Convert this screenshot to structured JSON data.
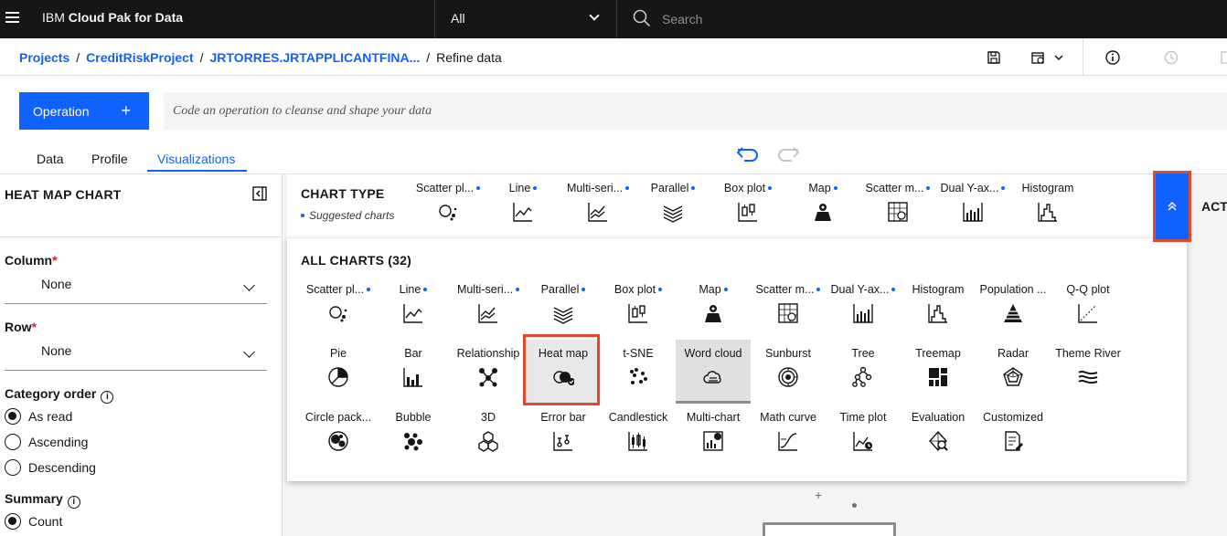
{
  "header": {
    "brand_prefix": "IBM ",
    "brand_name": "Cloud Pak for Data",
    "scope_value": "All",
    "search_placeholder": "Search"
  },
  "breadcrumb": {
    "items": [
      "Projects",
      "CreditRiskProject",
      "JRTORRES.JRTAPPLICANTFINA..."
    ],
    "current": "Refine data"
  },
  "operation": {
    "button_label": "Operation",
    "button_plus": "+",
    "code_placeholder": "Code an operation to cleanse and shape your data"
  },
  "tabs": [
    "Data",
    "Profile",
    "Visualizations"
  ],
  "active_tab": "Visualizations",
  "left_panel": {
    "title": "HEAT MAP CHART",
    "column_label": "Column",
    "column_value": "None",
    "row_label": "Row",
    "row_value": "None",
    "required_mark": "*",
    "category_order_label": "Category order",
    "category_order_options": [
      "As read",
      "Ascending",
      "Descending"
    ],
    "category_order_selected": "As read",
    "summary_label": "Summary",
    "summary_options": [
      "Count"
    ],
    "summary_selected": "Count"
  },
  "chart_type": {
    "title": "CHART TYPE",
    "suggested_note": "Suggested charts",
    "suggested": [
      {
        "label": "Scatter pl...",
        "icon": "scatter-plot-icon",
        "suggested": true
      },
      {
        "label": "Line",
        "icon": "line-chart-icon",
        "suggested": true
      },
      {
        "label": "Multi-seri...",
        "icon": "multi-series-icon",
        "suggested": true
      },
      {
        "label": "Parallel",
        "icon": "parallel-icon",
        "suggested": true
      },
      {
        "label": "Box plot",
        "icon": "box-plot-icon",
        "suggested": true
      },
      {
        "label": "Map",
        "icon": "map-icon",
        "suggested": true
      },
      {
        "label": "Scatter m...",
        "icon": "scatter-matrix-icon",
        "suggested": true
      },
      {
        "label": "Dual Y-ax...",
        "icon": "dual-y-axis-icon",
        "suggested": true
      },
      {
        "label": "Histogram",
        "icon": "histogram-icon",
        "suggested": false
      }
    ],
    "actions_label": "ACTI"
  },
  "all_charts": {
    "title": "ALL CHARTS (32)",
    "rows": [
      [
        {
          "label": "Scatter pl...",
          "icon": "scatter-plot-icon",
          "suggested": true
        },
        {
          "label": "Line",
          "icon": "line-chart-icon",
          "suggested": true
        },
        {
          "label": "Multi-seri...",
          "icon": "multi-series-icon",
          "suggested": true
        },
        {
          "label": "Parallel",
          "icon": "parallel-icon",
          "suggested": true
        },
        {
          "label": "Box plot",
          "icon": "box-plot-icon",
          "suggested": true
        },
        {
          "label": "Map",
          "icon": "map-icon",
          "suggested": true
        },
        {
          "label": "Scatter m...",
          "icon": "scatter-matrix-icon",
          "suggested": true
        },
        {
          "label": "Dual Y-ax...",
          "icon": "dual-y-axis-icon",
          "suggested": true
        },
        {
          "label": "Histogram",
          "icon": "histogram-icon",
          "suggested": false
        },
        {
          "label": "Population ...",
          "icon": "population-pyramid-icon",
          "suggested": false
        },
        {
          "label": "Q-Q plot",
          "icon": "qq-plot-icon",
          "suggested": false
        }
      ],
      [
        {
          "label": "Pie",
          "icon": "pie-chart-icon",
          "suggested": false
        },
        {
          "label": "Bar",
          "icon": "bar-chart-icon",
          "suggested": false
        },
        {
          "label": "Relationship",
          "icon": "relationship-icon",
          "suggested": false
        },
        {
          "label": "Heat map",
          "icon": "heat-map-icon",
          "suggested": false
        },
        {
          "label": "t-SNE",
          "icon": "tsne-icon",
          "suggested": false
        },
        {
          "label": "Word cloud",
          "icon": "word-cloud-icon",
          "suggested": false
        },
        {
          "label": "Sunburst",
          "icon": "sunburst-icon",
          "suggested": false
        },
        {
          "label": "Tree",
          "icon": "tree-icon",
          "suggested": false
        },
        {
          "label": "Treemap",
          "icon": "treemap-icon",
          "suggested": false
        },
        {
          "label": "Radar",
          "icon": "radar-icon",
          "suggested": false
        },
        {
          "label": "Theme River",
          "icon": "theme-river-icon",
          "suggested": false
        }
      ],
      [
        {
          "label": "Circle pack...",
          "icon": "circle-packing-icon",
          "suggested": false
        },
        {
          "label": "Bubble",
          "icon": "bubble-icon",
          "suggested": false
        },
        {
          "label": "3D",
          "icon": "3d-icon",
          "suggested": false
        },
        {
          "label": "Error bar",
          "icon": "error-bar-icon",
          "suggested": false
        },
        {
          "label": "Candlestick",
          "icon": "candlestick-icon",
          "suggested": false
        },
        {
          "label": "Multi-chart",
          "icon": "multi-chart-icon",
          "suggested": false
        },
        {
          "label": "Math curve",
          "icon": "math-curve-icon",
          "suggested": false
        },
        {
          "label": "Time plot",
          "icon": "time-plot-icon",
          "suggested": false
        },
        {
          "label": "Evaluation",
          "icon": "evaluation-icon",
          "suggested": false
        },
        {
          "label": "Customized",
          "icon": "customized-icon",
          "suggested": false
        }
      ]
    ],
    "selected": "Word cloud",
    "highlighted": "Heat map"
  },
  "colors": {
    "accent": "#0f62fe",
    "header_bg": "#161616",
    "highlight": "#e04a2a",
    "suggested_dot": "#0f62fe"
  }
}
